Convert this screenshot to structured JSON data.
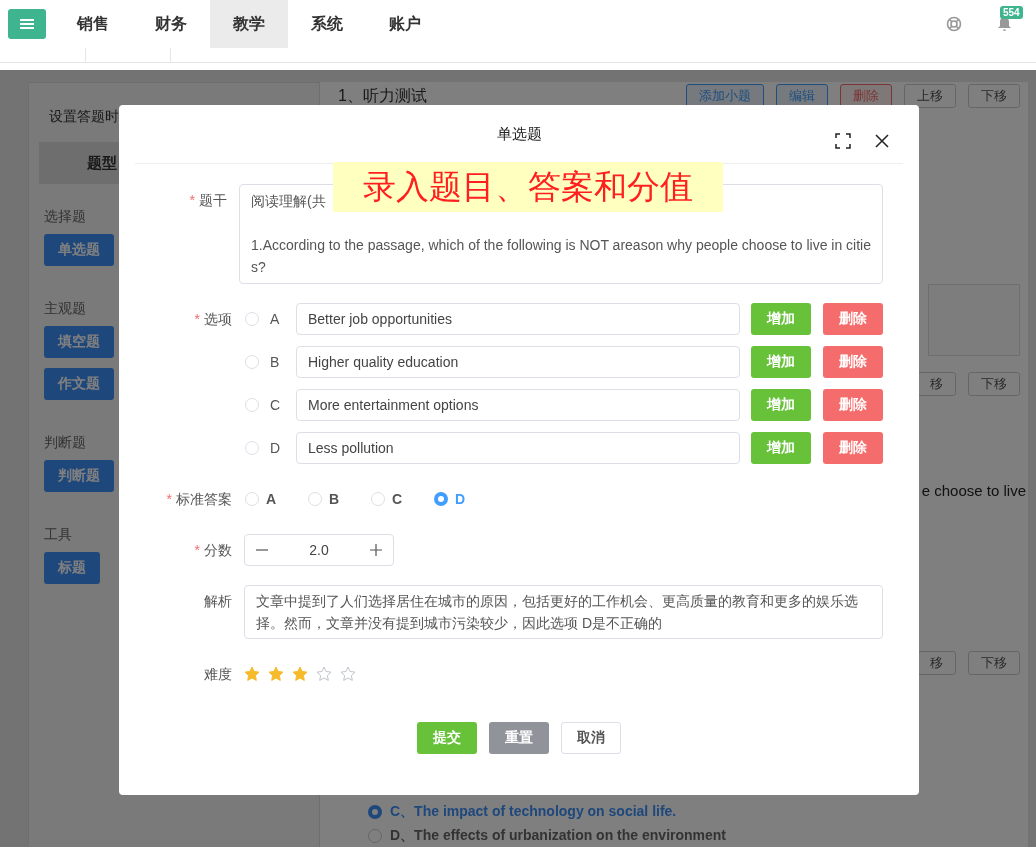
{
  "nav": {
    "tabs": [
      {
        "label": "销售",
        "selected": false
      },
      {
        "label": "财务",
        "selected": false
      },
      {
        "label": "教学",
        "selected": true
      },
      {
        "label": "系统",
        "selected": false
      },
      {
        "label": "账户",
        "selected": false
      }
    ],
    "badge": "554"
  },
  "sidebar": {
    "title": "设置答题时",
    "header": "题型",
    "groups": [
      {
        "label": "选择题",
        "items": [
          "单选题"
        ]
      },
      {
        "label": "主观题",
        "items": [
          "填空题",
          "作文题"
        ]
      },
      {
        "label": "判断题",
        "items": [
          "判断题"
        ]
      },
      {
        "label": "工具",
        "items": [
          "标题"
        ]
      }
    ]
  },
  "section": {
    "title": "1、听力测试",
    "actions": [
      {
        "label": "添加小题",
        "kind": "primary"
      },
      {
        "label": "编辑",
        "kind": "primary"
      },
      {
        "label": "删除",
        "kind": "danger"
      },
      {
        "label": "上移",
        "kind": "plain"
      },
      {
        "label": "下移",
        "kind": "plain"
      }
    ]
  },
  "row_actions": [
    [
      "移",
      "下移"
    ],
    [
      "移",
      "下移"
    ]
  ],
  "fragment": "e choose to live",
  "answers": [
    {
      "label": "C、The impact of technology on social life.",
      "selected": true
    },
    {
      "label": "D、The effects of urbanization on the environment",
      "selected": false
    }
  ],
  "dialog": {
    "title": "单选题",
    "callout": "录入题目、答案和分值",
    "stem_mark": "*",
    "stem_label": "题干",
    "stem_lines": [
      "阅读理解(共",
      "1.According to the passage, which of the following is NOT areason why people choose to live in citie",
      "s?"
    ],
    "options_mark": "*",
    "options_label": "选项",
    "options": [
      {
        "letter": "A",
        "text": "Better job opportunities",
        "selected": false,
        "add": "增加",
        "remove": "删除"
      },
      {
        "letter": "B",
        "text": "Higher quality education",
        "selected": false,
        "add": "增加",
        "remove": "删除"
      },
      {
        "letter": "C",
        "text": "More entertainment options",
        "selected": false,
        "add": "增加",
        "remove": "删除"
      },
      {
        "letter": "D",
        "text": "Less pollution",
        "selected": false,
        "add": "增加",
        "remove": "删除"
      }
    ],
    "answer_mark": "*",
    "answer_label": "标准答案",
    "answer_choices": [
      {
        "label": "A",
        "selected": false
      },
      {
        "label": "B",
        "selected": false
      },
      {
        "label": "C",
        "selected": false
      },
      {
        "label": "D",
        "selected": true
      }
    ],
    "score_mark": "*",
    "score_label": "分数",
    "score": "2.0",
    "analysis_label": "解析",
    "analysis": "文章中提到了人们选择居住在城市的原因，包括更好的工作机会、更高质量的教育和更多的娱乐选择。然而，文章并没有提到城市污染较少，因此选项 D是不正确的",
    "difficulty_label": "难度",
    "difficulty": {
      "stars": 3
    },
    "buttons": [
      {
        "label": "提交",
        "kind": "submit"
      },
      {
        "label": "重置",
        "kind": "reset"
      },
      {
        "label": "取消",
        "kind": "cancel"
      }
    ]
  }
}
